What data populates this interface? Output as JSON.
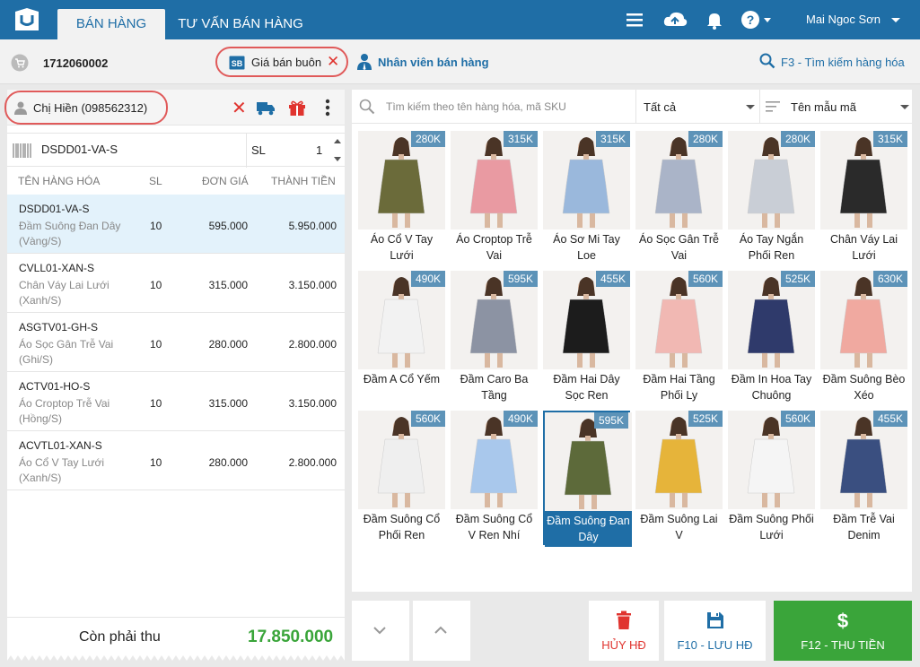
{
  "topbar": {
    "tabs": [
      {
        "label": "BÁN HÀNG",
        "active": true
      },
      {
        "label": "TƯ VẤN BÁN HÀNG",
        "active": false
      }
    ],
    "user_name": "Mai Ngoc Sơn",
    "icons": [
      "menu-icon",
      "cloud-sync-icon",
      "bell-icon",
      "help-icon"
    ],
    "color": "#1f6ea6"
  },
  "subbar": {
    "order_number": "1712060002",
    "price_list_label": "Giá bán buôn",
    "staff_label": "Nhân viên bán hàng",
    "search_label": "F3 - Tìm kiếm hàng hóa"
  },
  "customer": {
    "label": "Chị Hiền (098562312)"
  },
  "sku_entry": {
    "value": "DSDD01-VA-S",
    "qty_label": "SL",
    "qty_value": "1"
  },
  "cart": {
    "columns": [
      "TÊN HÀNG HÓA",
      "SL",
      "ĐƠN GIÁ",
      "THÀNH TIỀN"
    ],
    "rows": [
      {
        "code": "DSDD01-VA-S",
        "name": "Đầm Suông Đan Dây (Vàng/S)",
        "qty": "10",
        "price": "595.000",
        "total": "5.950.000",
        "selected": true
      },
      {
        "code": "CVLL01-XAN-S",
        "name": "Chân Váy Lai Lưới (Xanh/S)",
        "qty": "10",
        "price": "315.000",
        "total": "3.150.000",
        "selected": false
      },
      {
        "code": "ASGTV01-GH-S",
        "name": "Áo Sọc Gân Trễ Vai (Ghi/S)",
        "qty": "10",
        "price": "280.000",
        "total": "2.800.000",
        "selected": false
      },
      {
        "code": "ACTV01-HO-S",
        "name": "Áo Croptop Trễ Vai (Hồng/S)",
        "qty": "10",
        "price": "315.000",
        "total": "3.150.000",
        "selected": false
      },
      {
        "code": "ACVTL01-XAN-S",
        "name": "Áo Cổ V Tay Lưới (Xanh/S)",
        "qty": "10",
        "price": "280.000",
        "total": "2.800.000",
        "selected": false
      }
    ],
    "remaining_label": "Còn phải thu",
    "remaining_amount": "17.850.000"
  },
  "catalog": {
    "search_placeholder": "Tìm kiếm theo tên hàng hóa, mã SKU",
    "filter_value": "Tất cả",
    "sort_value": "Tên mẫu mã",
    "products": [
      {
        "price": "280K",
        "name": "Áo Cổ V Tay Lưới",
        "color": "#6b6b3a"
      },
      {
        "price": "315K",
        "name": "Áo Croptop Trễ Vai",
        "color": "#e99aa2"
      },
      {
        "price": "315K",
        "name": "Áo Sơ Mi Tay Loe",
        "color": "#9ab8dc"
      },
      {
        "price": "280K",
        "name": "Áo Sọc Gân Trễ Vai",
        "color": "#aab4c8"
      },
      {
        "price": "280K",
        "name": "Áo Tay Ngắn Phối Ren",
        "color": "#c9ced6"
      },
      {
        "price": "315K",
        "name": "Chân Váy Lai Lưới",
        "color": "#2a2a2a"
      },
      {
        "price": "490K",
        "name": "Đầm A Cổ Yếm",
        "color": "#f2f2f2"
      },
      {
        "price": "595K",
        "name": "Đầm Caro Ba Tầng",
        "color": "#8c93a3"
      },
      {
        "price": "455K",
        "name": "Đầm Hai Dây Sọc Ren",
        "color": "#1c1c1c"
      },
      {
        "price": "560K",
        "name": "Đầm Hai Tầng Phối Ly",
        "color": "#f1b8b3"
      },
      {
        "price": "525K",
        "name": "Đầm In Hoa Tay Chuông",
        "color": "#2f3a6b"
      },
      {
        "price": "630K",
        "name": "Đầm Suông Bèo Xéo",
        "color": "#f0a9a0"
      },
      {
        "price": "560K",
        "name": "Đầm Suông Cổ Phối Ren",
        "color": "#efefef"
      },
      {
        "price": "490K",
        "name": "Đầm Suông Cổ V Ren Nhí",
        "color": "#a9c8ec"
      },
      {
        "price": "595K",
        "name": "Đầm Suông Đan Dây",
        "color": "#5d6a3a",
        "active": true
      },
      {
        "price": "525K",
        "name": "Đầm Suông Lai V",
        "color": "#e6b43a"
      },
      {
        "price": "560K",
        "name": "Đầm Suông Phối Lưới",
        "color": "#f5f5f5"
      },
      {
        "price": "455K",
        "name": "Đầm Trễ Vai Denim",
        "color": "#3a4f80"
      }
    ]
  },
  "actions": {
    "cancel_label": "HỦY HĐ",
    "save_label": "F10 - LƯU HĐ",
    "pay_label": "F12 - THU TIỀN",
    "cancel_color": "#e0342f",
    "save_color": "#1f6ea6",
    "pay_color": "#3aa53a"
  }
}
